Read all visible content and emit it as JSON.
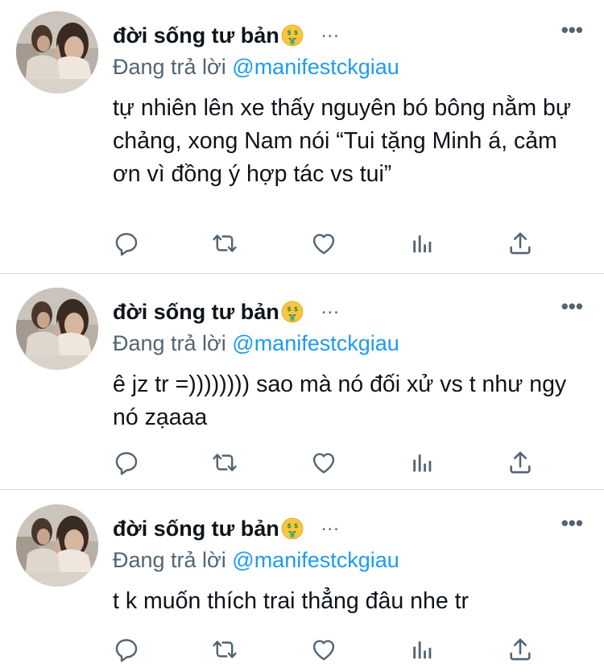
{
  "tweets": [
    {
      "author": "đời sống tư bản",
      "more_icon": "•••",
      "inline_dots": "...",
      "reply_prefix": "Đang trả lời",
      "reply_handle": "@manifestckgiau",
      "text": "tự nhiên lên xe thấy nguyên bó bông nằm bự chảng, xong Nam nói “Tui tặng Minh á, cảm ơn vì đồng ý hợp tác vs tui”"
    },
    {
      "author": "đời sống tư bản",
      "more_icon": "•••",
      "inline_dots": "...",
      "reply_prefix": "Đang trả lời",
      "reply_handle": "@manifestckgiau",
      "text": "ê jz tr =)))))))) sao mà nó đối xử vs t như ngy nó zạaaa"
    },
    {
      "author": "đời sống tư bản",
      "more_icon": "•••",
      "inline_dots": "...",
      "reply_prefix": "Đang trả lời",
      "reply_handle": "@manifestckgiau",
      "text": "t k muốn thích trai thẳng đâu nhe tr"
    }
  ],
  "icons": {
    "reply": "reply-icon",
    "retweet": "retweet-icon",
    "like": "heart-icon",
    "views": "views-icon",
    "share": "share-icon",
    "name_emoji": "money-mouth-face-emoji"
  },
  "colors": {
    "text": "#0f1419",
    "secondary": "#536471",
    "link": "#1d9bf0",
    "divider": "#d9dee2"
  }
}
